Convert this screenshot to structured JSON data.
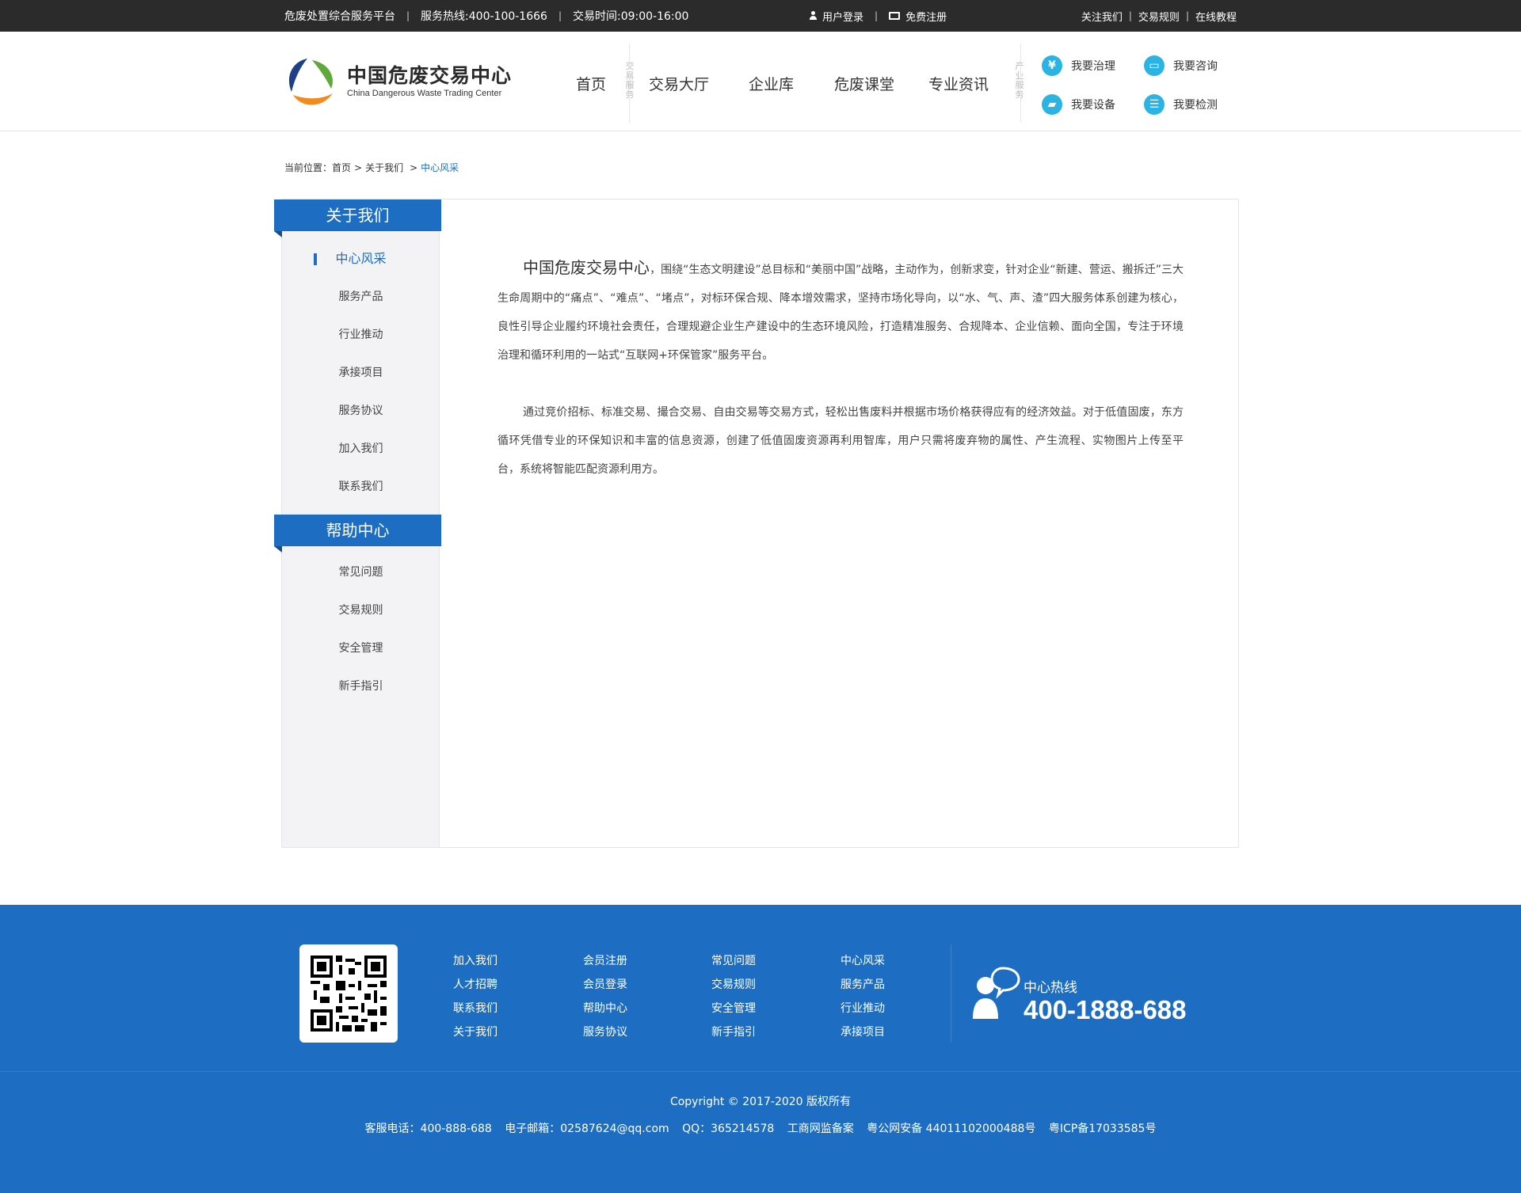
{
  "topbar": {
    "platform": "危废处置综合服务平台",
    "hotline": "服务热线:400-100-1666",
    "hours": "交易时间:09:00-16:00",
    "login": "用户登录",
    "register": "免费注册",
    "follow": "关注我们",
    "rules": "交易规则",
    "tutorial": "在线教程"
  },
  "header": {
    "logo_cn": "中国危废交易中心",
    "logo_en": "China Dangerous Waste Trading Center",
    "nav": [
      "首页",
      "交易大厅",
      "企业库",
      "危废课堂",
      "专业资讯"
    ],
    "trade_service_label": "交易服务",
    "industry_service_label": "产业服务",
    "services": [
      {
        "label": "我要治理",
        "icon": "yen-icon",
        "glyph": "¥"
      },
      {
        "label": "我要咨询",
        "icon": "card-icon",
        "glyph": "▭"
      },
      {
        "label": "我要设备",
        "icon": "truck-icon",
        "glyph": "▰"
      },
      {
        "label": "我要检测",
        "icon": "list-icon",
        "glyph": "☰"
      }
    ]
  },
  "breadcrumb": {
    "prefix": "当前位置：",
    "items": [
      "首页",
      "关于我们"
    ],
    "current": "中心风采"
  },
  "sidebar": {
    "about_title": "关于我们",
    "about_items": [
      "中心风采",
      "服务产品",
      "行业推动",
      "承接项目",
      "服务协议",
      "加入我们",
      "联系我们"
    ],
    "help_title": "帮助中心",
    "help_items": [
      "常见问题",
      "交易规则",
      "安全管理",
      "新手指引"
    ]
  },
  "content": {
    "lead": "中国危废交易中心",
    "p1": "，围绕“生态文明建设”总目标和“美丽中国”战略，主动作为，创新求变，针对企业“新建、营运、搬拆迁”三大生命周期中的“痛点”、“难点”、“堵点”，对标环保合规、降本增效需求，坚持市场化导向，以“水、气、声、渣”四大服务体系创建为核心，良性引导企业履约环境社会责任，合理规避企业生产建设中的生态环境风险，打造精准服务、合规降本、企业信赖、面向全国，专注于环境治理和循环利用的一站式“互联网+环保管家”服务平台。",
    "p2": "通过竞价招标、标准交易、撮合交易、自由交易等交易方式，轻松出售废料并根据市场价格获得应有的经济效益。对于低值固废，东方循环凭借专业的环保知识和丰富的信息资源，创建了低值固废资源再利用智库，用户只需将废弃物的属性、产生流程、实物图片上传至平台，系统将智能匹配资源利用方。"
  },
  "footer": {
    "col1": [
      "加入我们",
      "人才招聘",
      "联系我们",
      "关于我们"
    ],
    "col2": [
      "会员注册",
      "会员登录",
      "帮助中心",
      "服务协议"
    ],
    "col3": [
      "常见问题",
      "交易规则",
      "安全管理",
      "新手指引"
    ],
    "col4": [
      "中心风采",
      "服务产品",
      "行业推动",
      "承接项目"
    ],
    "hotline_label": "中心热线",
    "hotline_number": "400-1888-688",
    "copyright": "Copyright © 2017-2020  版权所有",
    "contact": {
      "phone": "客服电话：400-888-688",
      "email": "电子邮箱：02587624@qq.com",
      "qq": "QQ：365214578",
      "supervision": "工商网监备案",
      "police": "粤公网安备 44011102000488号",
      "icp": "粤ICP备17033585号"
    }
  },
  "colors": {
    "brand_blue": "#1d6ec3",
    "topbar_bg": "#2b2b2b",
    "icon_cyan": "#2bb3e3",
    "sidebar_bg": "#f3f3f5"
  }
}
